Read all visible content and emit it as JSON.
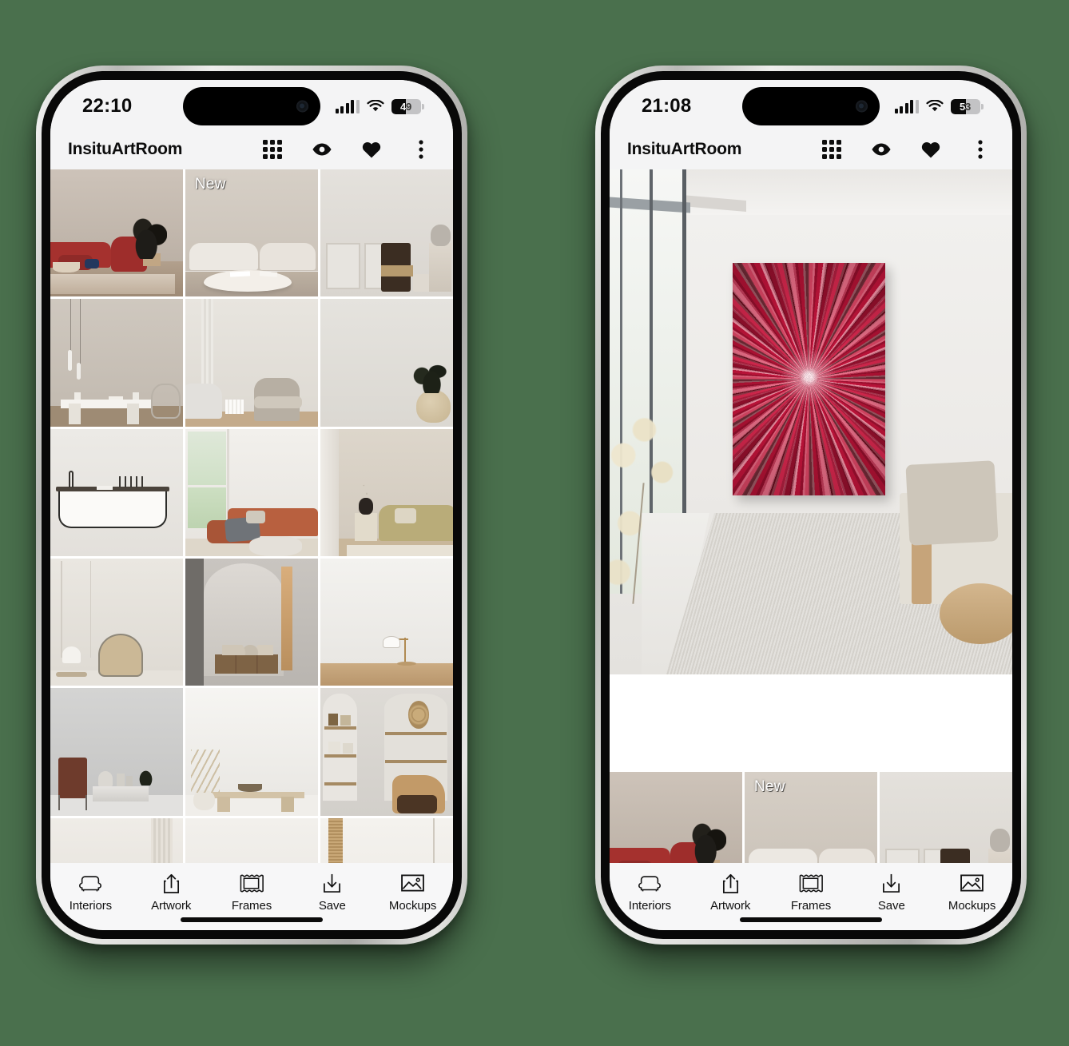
{
  "meta": {
    "background_color": "#4a704d",
    "accent_color": "#c2143c"
  },
  "phones": [
    {
      "id": "phone-gallery",
      "status": {
        "time": "22:10",
        "battery_percent": "49",
        "battery_level": 49,
        "signal_icon": "cellular-signal-icon",
        "wifi_icon": "wifi-icon",
        "battery_icon": "battery-icon"
      },
      "appbar": {
        "title": "InsituArtRoom",
        "actions": [
          {
            "name": "grid-view-icon",
            "label": "Grid view"
          },
          {
            "name": "eye-icon",
            "label": "Preview"
          },
          {
            "name": "heart-icon",
            "label": "Favorites"
          },
          {
            "name": "more-vertical-icon",
            "label": "More options"
          }
        ]
      },
      "grid": {
        "badge_new": "New",
        "columns": 3,
        "items": [
          {
            "scene": "s1",
            "alt": "Living room with red boucle sofa and plant",
            "badge": ""
          },
          {
            "scene": "s2",
            "alt": "White boucle sofa with oval coffee table",
            "badge": "New"
          },
          {
            "scene": "s3",
            "alt": "Panelled wall with dark wood chair and vase",
            "badge": ""
          },
          {
            "scene": "s4",
            "alt": "Marble console with pendant lights",
            "badge": ""
          },
          {
            "scene": "s5",
            "alt": "Bedroom corner with chair and books",
            "badge": ""
          },
          {
            "scene": "s6",
            "alt": "Empty wall with olive plant in vase",
            "badge": ""
          },
          {
            "scene": "s7",
            "alt": "Freestanding bathtub with candles",
            "badge": ""
          },
          {
            "scene": "s8",
            "alt": "Window view with terracotta sofa",
            "badge": ""
          },
          {
            "scene": "s9",
            "alt": "Olive puffy sofa with side table",
            "badge": ""
          },
          {
            "scene": "s10",
            "alt": "Rattan chair with dome table lamp",
            "badge": ""
          },
          {
            "scene": "s11",
            "alt": "Arched niche with wooden sideboard",
            "badge": ""
          },
          {
            "scene": "s12",
            "alt": "Desk lamp on wooden shelf",
            "badge": ""
          },
          {
            "scene": "s13",
            "alt": "Leather chair with concrete coffee table",
            "badge": ""
          },
          {
            "scene": "s14",
            "alt": "Travertine bench with fan palm",
            "badge": ""
          },
          {
            "scene": "s15",
            "alt": "Shelving niches with cork lounge chair",
            "badge": ""
          },
          {
            "scene": "sA",
            "alt": "Partial interior row",
            "badge": ""
          },
          {
            "scene": "sB",
            "alt": "Partial interior row",
            "badge": ""
          },
          {
            "scene": "sC",
            "alt": "Partial interior row",
            "badge": ""
          }
        ]
      },
      "tabbar": {
        "items": [
          {
            "icon": "armchair-icon",
            "label": "Interiors",
            "active": true
          },
          {
            "icon": "share-up-icon",
            "label": "Artwork",
            "active": false
          },
          {
            "icon": "frame-icon",
            "label": "Frames",
            "active": false
          },
          {
            "icon": "download-icon",
            "label": "Save",
            "active": false
          },
          {
            "icon": "image-icon",
            "label": "Mockups",
            "active": false
          }
        ]
      }
    },
    {
      "id": "phone-preview",
      "status": {
        "time": "21:08",
        "battery_percent": "53",
        "battery_level": 53,
        "signal_icon": "cellular-signal-icon",
        "wifi_icon": "wifi-icon",
        "battery_icon": "battery-icon"
      },
      "appbar": {
        "title": "InsituArtRoom",
        "actions": [
          {
            "name": "grid-view-icon",
            "label": "Grid view"
          },
          {
            "name": "eye-icon",
            "label": "Preview"
          },
          {
            "name": "heart-icon",
            "label": "Favorites"
          },
          {
            "name": "more-vertical-icon",
            "label": "More options"
          }
        ]
      },
      "preview": {
        "room_alt": "Bright minimal room with floor to ceiling window, linen armchair and round wood table",
        "artwork": {
          "alt": "Abstract crimson radial burst artwork on canvas",
          "dominant_colors": [
            "#c2143c",
            "#e0506e",
            "#8e0f2c",
            "#f08aa0",
            "#6e1020"
          ]
        }
      },
      "grid": {
        "badge_new": "New",
        "columns": 3,
        "items": [
          {
            "scene": "s1",
            "alt": "Living room with red boucle sofa and plant",
            "badge": ""
          },
          {
            "scene": "s2",
            "alt": "White boucle sofa with oval coffee table",
            "badge": "New"
          },
          {
            "scene": "s3",
            "alt": "Panelled wall with dark wood chair and vase",
            "badge": ""
          }
        ]
      },
      "tabbar": {
        "items": [
          {
            "icon": "armchair-icon",
            "label": "Interiors",
            "active": true
          },
          {
            "icon": "share-up-icon",
            "label": "Artwork",
            "active": false
          },
          {
            "icon": "frame-icon",
            "label": "Frames",
            "active": false
          },
          {
            "icon": "download-icon",
            "label": "Save",
            "active": false
          },
          {
            "icon": "image-icon",
            "label": "Mockups",
            "active": false
          }
        ]
      }
    }
  ]
}
